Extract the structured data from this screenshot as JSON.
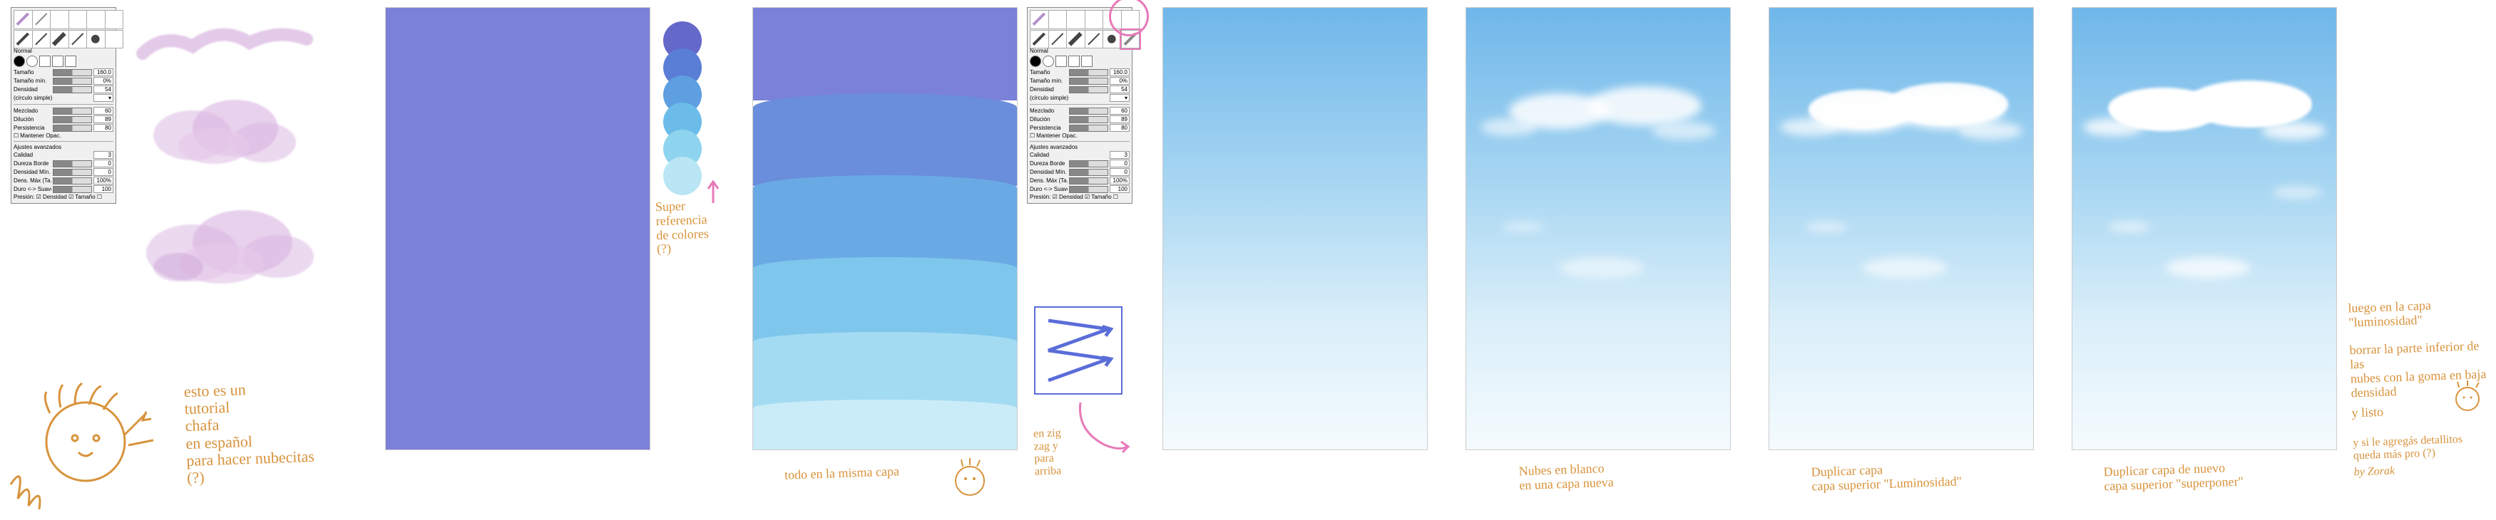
{
  "panel": {
    "labels": {
      "normal": "Normal",
      "size": "Tamaño",
      "min_size": "Tamaño mín.",
      "density": "Densidad",
      "simple_circle": "(círculo simple)",
      "blending": "Mezclado",
      "dilution": "Dilución",
      "persistence": "Persistencia",
      "keep_opacity": "Mantener Opac.",
      "advanced": "Ajustes avanzados",
      "quality": "Calidad",
      "edge_hardness": "Dureza Borde",
      "min_density": "Densidad Mín.",
      "max_density": "Dens. Máx (Ta...)",
      "hard_soft": "Duro <-> Suave",
      "pressure": "Presión: ☑ Densidad ☑ Tamaño ☐"
    },
    "values": {
      "size": "160.0",
      "min_size": "0%",
      "density": "54",
      "blending": "60",
      "dilution": "89",
      "persistence": "80",
      "quality": "3",
      "edge_hardness": "0",
      "min_density": "0",
      "max_density": "100%",
      "hard_soft": "100"
    }
  },
  "annotations": {
    "intro1": "esto es un",
    "intro2": "tutorial",
    "intro3": "chafa",
    "intro4": "en español",
    "intro5": "para hacer nubecitas",
    "intro6": "(?)",
    "color_ref1": "Super",
    "color_ref2": "referencia",
    "color_ref3": "de colores",
    "color_ref4": "(?)",
    "same_layer": "todo en la misma capa",
    "zigzag1": "en zig",
    "zigzag2": "zag y",
    "zigzag3": "para",
    "zigzag4": "arriba",
    "white_clouds1": "Nubes en blanco",
    "white_clouds2": "en una capa nueva",
    "dup1a": "Duplicar capa",
    "dup1b": "capa superior \"Luminosidad\"",
    "dup2a": "Duplicar capa de nuevo",
    "dup2b": "capa superior \"superponer\"",
    "final1": "luego en la capa \"luminosidad\"",
    "final2": "borrar la parte inferior de las",
    "final3": "nubes con la goma en baja",
    "final4": "densidad",
    "final5": "y listo",
    "final6": "y si le agregás detallitos",
    "final7": "queda más pro (?)",
    "signature": "by Zorak"
  },
  "swatches": [
    "#6468c9",
    "#5a7ed6",
    "#5d9fe0",
    "#6cbce9",
    "#8fd4ee",
    "#b9e5f4"
  ]
}
